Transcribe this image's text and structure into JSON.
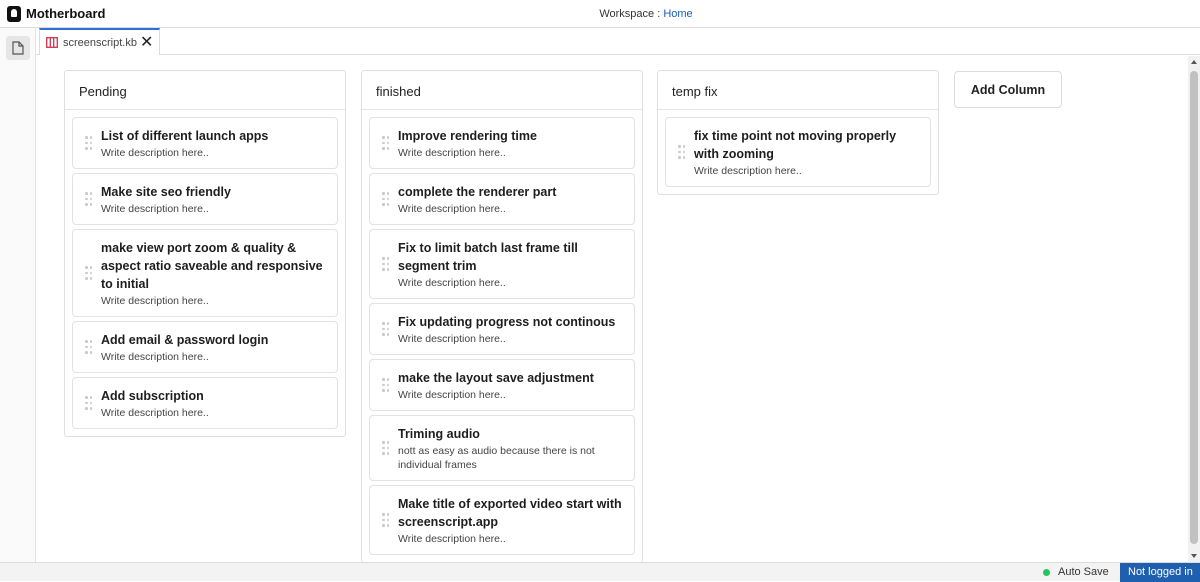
{
  "app": {
    "title": "Motherboard"
  },
  "workspace": {
    "label": "Workspace : ",
    "link": "Home"
  },
  "tab": {
    "label": "screenscript.kb",
    "close": "✕"
  },
  "columns": [
    {
      "title": "Pending",
      "cards": [
        {
          "title": "List of different launch apps",
          "desc": "Write description here.."
        },
        {
          "title": "Make site seo friendly",
          "desc": "Write description here.."
        },
        {
          "title": "make view port zoom & quality & aspect ratio saveable and responsive to initial",
          "desc": "Write description here.."
        },
        {
          "title": "Add email & password login",
          "desc": "Write description here.."
        },
        {
          "title": "Add subscription",
          "desc": "Write description here.."
        }
      ]
    },
    {
      "title": "finished",
      "cards": [
        {
          "title": "Improve rendering time",
          "desc": "Write description here.."
        },
        {
          "title": "complete the renderer part",
          "desc": "Write description here.."
        },
        {
          "title": "Fix to limit batch last frame till segment trim",
          "desc": "Write description here.."
        },
        {
          "title": "Fix updating progress not continous",
          "desc": "Write description here.."
        },
        {
          "title": "make the layout save adjustment",
          "desc": "Write description here.."
        },
        {
          "title": "Triming audio",
          "desc": "nott as easy as audio because there is not individual frames"
        },
        {
          "title": "Make title of exported video start with screenscript.app",
          "desc": "Write description here.."
        }
      ]
    },
    {
      "title": "temp fix",
      "cards": [
        {
          "title": "fix time point not moving properly with zooming",
          "desc": "Write description here.."
        }
      ]
    }
  ],
  "add_column_label": "Add Column",
  "status": {
    "autosave": "Auto Save",
    "login": "Not logged in"
  },
  "colors": {
    "accent": "#1f5fb0",
    "autosave_dot": "#22c55e",
    "tab_icon": "#d0334a"
  }
}
